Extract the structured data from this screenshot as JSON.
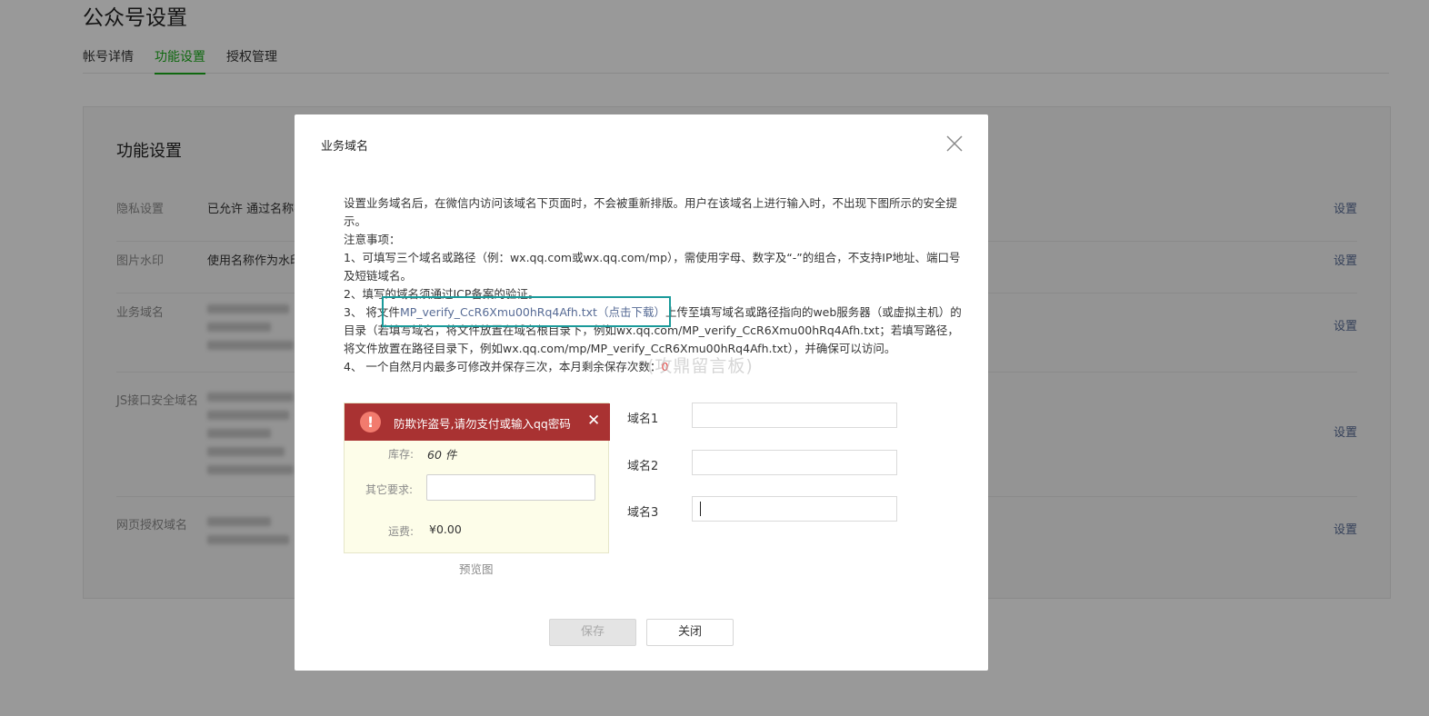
{
  "page": {
    "title": "公众号设置",
    "tabs": [
      "帐号详情",
      "功能设置",
      "授权管理"
    ],
    "active_tab": "功能设置",
    "panel_title": "功能设置",
    "rows": [
      {
        "label": "隐私设置",
        "value": "已允许 通过名称拉",
        "action": "设置"
      },
      {
        "label": "图片水印",
        "value": "使用名称作为水印",
        "action": "设置"
      },
      {
        "label": "业务域名",
        "value": "",
        "action": "设置"
      },
      {
        "label": "JS接口安全域名",
        "value": "",
        "action": "设置"
      },
      {
        "label": "网页授权域名",
        "value": "",
        "action": "设置"
      }
    ]
  },
  "dialog": {
    "title": "业务域名",
    "intro": "设置业务域名后，在微信内访问该域名下页面时，不会被重新排版。用户在该域名上进行输入时，不出现下图所示的安全提示。",
    "notice_title": "注意事项：",
    "item1": "1、可填写三个域名或路径（例：wx.qq.com或wx.qq.com/mp），需使用字母、数字及“-”的组合，不支持IP地址、端口号及短链域名。",
    "item2": "2、填写的域名须通过ICP备案的验证。",
    "item3_prefix": "3、 将文件",
    "item3_link": "MP_verify_CcR6Xmu00hRq4Afh.txt（点击下载）",
    "item3_suffix": "上传至填写域名或路径指向的web服务器（或虚拟主机）的目录（若填写域名，将文件放置在域名根目录下，例如wx.qq.com/MP_verify_CcR6Xmu00hRq4Afh.txt；若填写路径，将文件放置在路径目录下，例如wx.qq.com/mp/MP_verify_CcR6Xmu00hRq4Afh.txt），并确保可以访问。",
    "item4_prefix": "4、 一个自然月内最多可修改并保存三次，本月剩余保存次数：",
    "remaining": "0",
    "watermark": "(攻鼎留言板)",
    "preview": {
      "warning": "防欺诈盗号,请勿支付或输入qq密码",
      "stock_label": "库存:",
      "stock_value": "60 件",
      "other_label": "其它要求:",
      "shipping_label": "运费:",
      "shipping_value": "¥0.00",
      "caption": "预览图"
    },
    "domains": [
      {
        "label": "域名1",
        "value": ""
      },
      {
        "label": "域名2",
        "value": ""
      },
      {
        "label": "域名3",
        "value": ""
      }
    ],
    "save_label": "保存",
    "close_label": "关闭"
  },
  "colors": {
    "accent": "#1aad19",
    "link": "#576b95",
    "warning_bar": "#a93232",
    "highlight": "#1a9a9a"
  }
}
